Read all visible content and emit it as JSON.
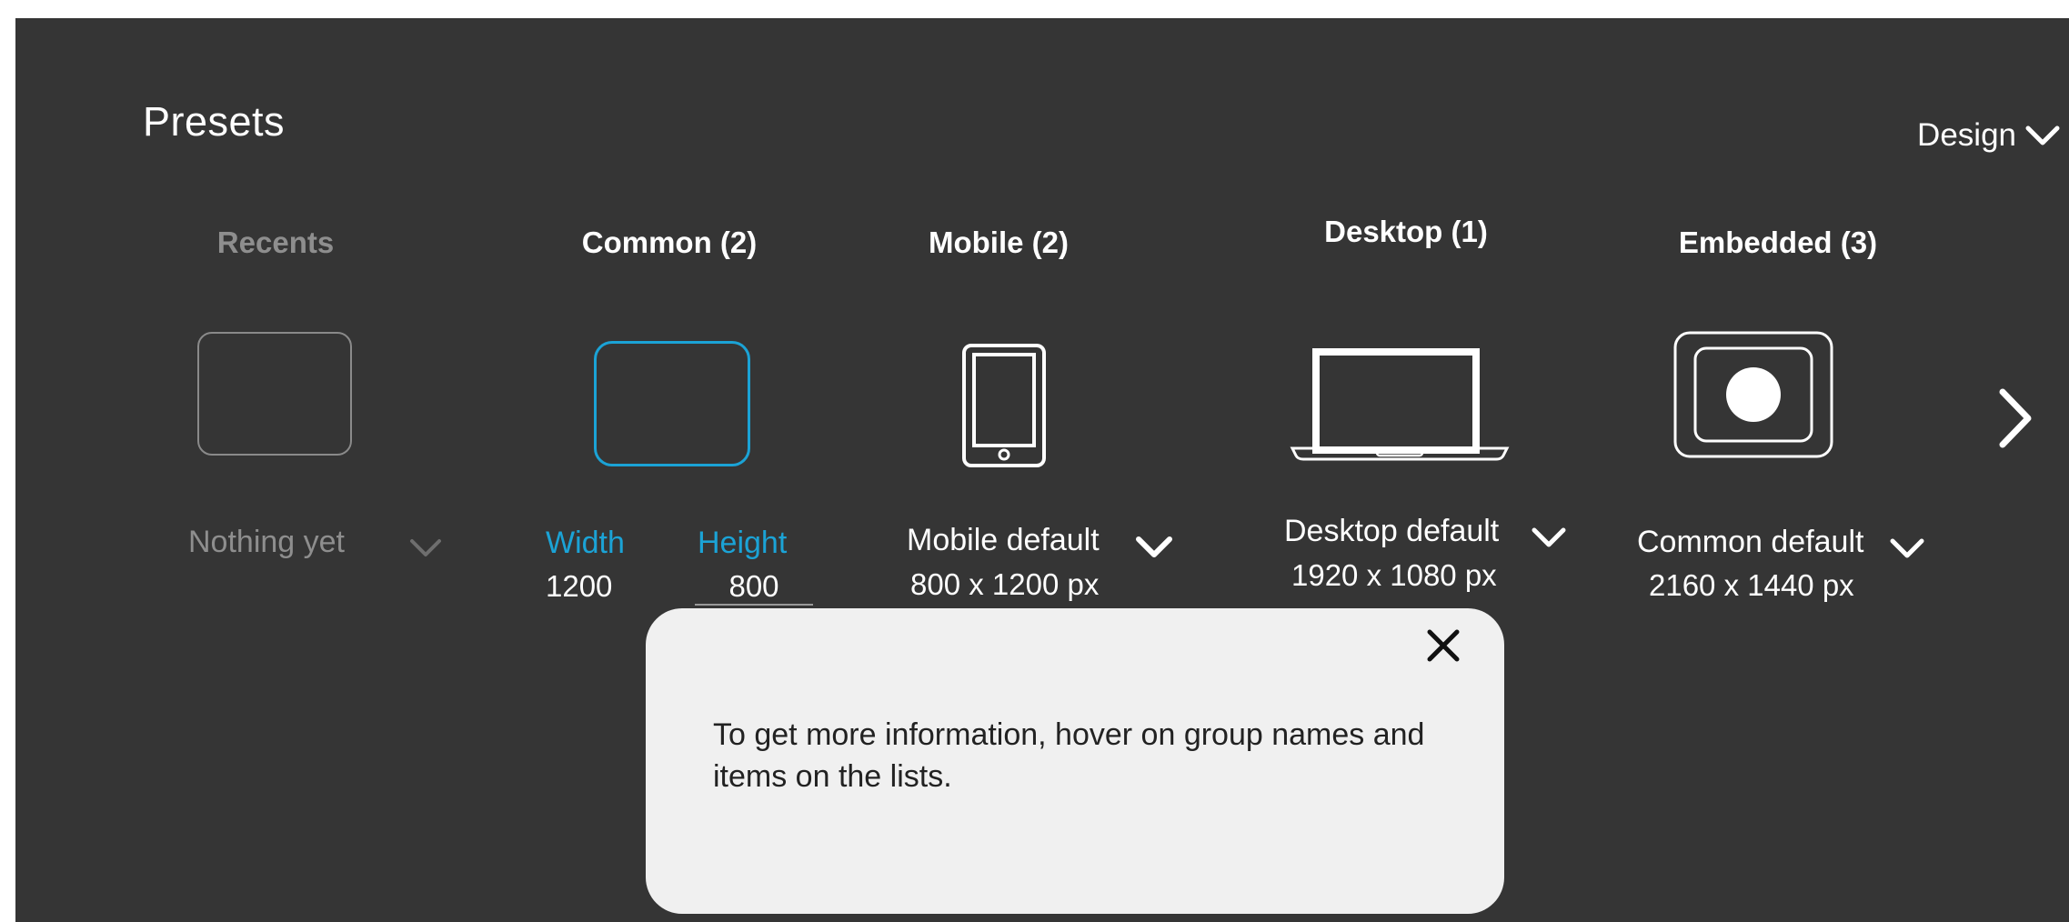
{
  "header": {
    "title": "Presets",
    "mode_label": "Design"
  },
  "categories": [
    {
      "label": "Recents"
    },
    {
      "label": "Common (2)"
    },
    {
      "label": "Mobile (2)"
    },
    {
      "label": "Desktop (1)"
    },
    {
      "label": "Embedded (3)"
    }
  ],
  "recents": {
    "empty_text": "Nothing yet"
  },
  "common": {
    "width_label": "Width",
    "height_label": "Height",
    "width_value": "1200",
    "height_value": "800"
  },
  "mobile": {
    "preset_name": "Mobile default",
    "dimensions": "800 x 1200 px"
  },
  "desktop": {
    "preset_name": "Desktop  default",
    "dimensions": "1920 x 1080 px"
  },
  "embedded": {
    "preset_name": "Common  default",
    "dimensions": "2160 x 1440 px"
  },
  "tooltip": {
    "message": "To get more information, hover on group names and items on the lists."
  },
  "colors": {
    "background": "#353535",
    "accent": "#1ba3d6",
    "muted": "#8e8e8e",
    "tooltip_bg": "#f0f0f0"
  },
  "icons": {
    "mode": "chevron-down-icon",
    "next": "chevron-right-icon",
    "close": "close-icon",
    "mobile": "phone-icon",
    "desktop": "laptop-icon",
    "embedded": "embedded-device-icon"
  }
}
